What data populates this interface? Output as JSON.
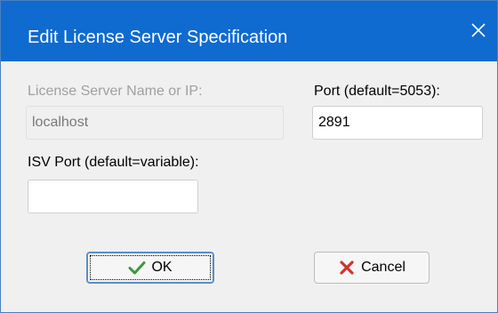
{
  "window": {
    "title": "Edit License Server Specification",
    "close_icon": "close-icon"
  },
  "server_name": {
    "label": "License Server Name or IP:",
    "value": "localhost"
  },
  "port": {
    "label": "Port (default=5053):",
    "value": "2891"
  },
  "isv_port": {
    "label": "ISV Port (default=variable):",
    "value": ""
  },
  "buttons": {
    "ok_label": "OK",
    "ok_icon": "checkmark-icon",
    "cancel_label": "Cancel",
    "cancel_icon": "x-icon"
  },
  "colors": {
    "titlebar": "#0f6bd0",
    "ok_check": "#3a9a3a",
    "cancel_x": "#d0342c"
  }
}
